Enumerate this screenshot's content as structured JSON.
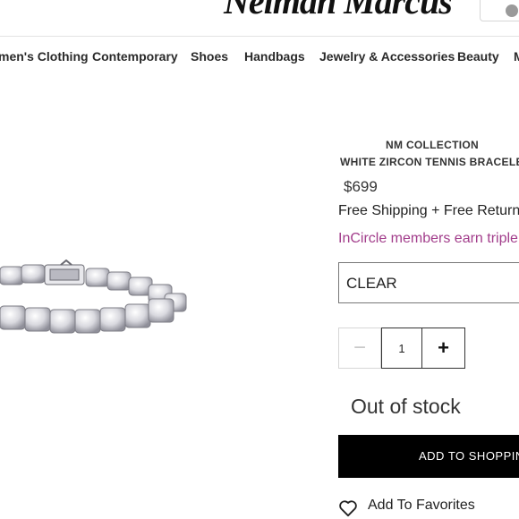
{
  "header": {
    "logo_text": "Neiman Marcus",
    "search_icon": "search-icon"
  },
  "nav": {
    "items": [
      {
        "label": "men's Clothing"
      },
      {
        "label": "Contemporary"
      },
      {
        "label": "Shoes"
      },
      {
        "label": "Handbags"
      },
      {
        "label": "Jewelry & Accessories"
      },
      {
        "label": "Beauty"
      },
      {
        "label": "M"
      }
    ]
  },
  "product": {
    "image_icon": "bracelet-image",
    "brand": "NM COLLECTION",
    "name": "WHITE ZIRCON TENNIS BRACELET",
    "price": "$699",
    "shipping": "Free Shipping + Free Returns",
    "promo": "InCircle members earn triple",
    "color_select": "CLEAR",
    "quantity": "1",
    "qty_minus": "−",
    "qty_plus": "+",
    "stock_status": "Out of stock",
    "add_button": "ADD TO SHOPPING",
    "favorites": "Add To Favorites",
    "favorites_icon": "heart-icon",
    "promo_color": "#a23d8b"
  }
}
